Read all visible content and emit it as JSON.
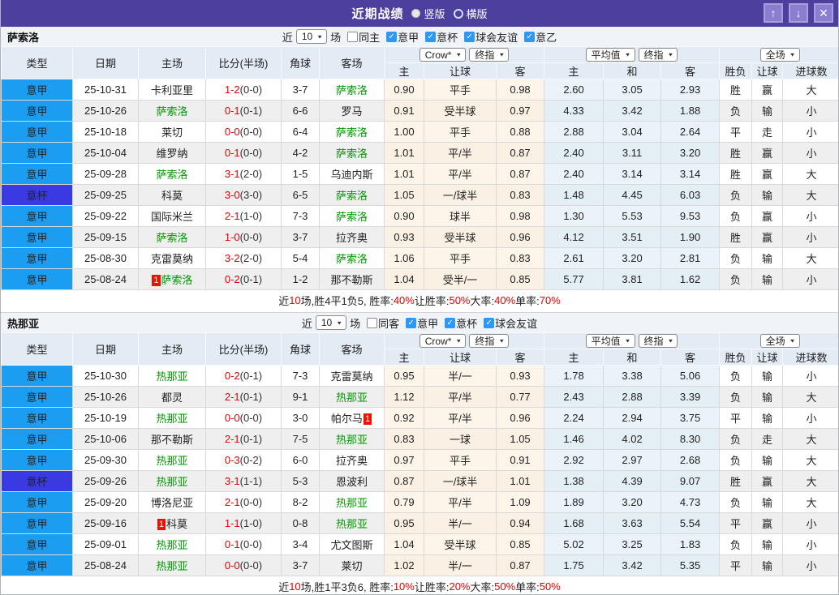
{
  "titlebar": {
    "title": "近期战绩",
    "radios": [
      {
        "label": "竖版",
        "selected": true
      },
      {
        "label": "横版",
        "selected": false
      }
    ],
    "buttons": {
      "up": "↑",
      "down": "↓",
      "close": "✕"
    }
  },
  "icons": {
    "chevron": "▼",
    "check": "✓"
  },
  "colors": {
    "header_purple": "#4c3f9d",
    "league_badge": "#1b9df2",
    "cup_badge": "#3a3ae2",
    "red": "#e60000",
    "blue": "#2433cc",
    "green": "#1f9e3d",
    "team_green": "#009900"
  },
  "header": {
    "main": [
      "类型",
      "日期",
      "主场",
      "比分(半场)",
      "角球",
      "客场"
    ],
    "odds_group": [
      "Crow*",
      "终指"
    ],
    "avg_group": [
      "平均值",
      "终指"
    ],
    "scope_group": [
      "全场"
    ],
    "sub": [
      "主",
      "让球",
      "客",
      "主",
      "和",
      "客",
      "胜负",
      "让球",
      "进球数"
    ]
  },
  "sections": [
    {
      "team": "萨索洛",
      "filter": {
        "prefix": "近",
        "games": "10",
        "suffix": "场",
        "same_label": "同主",
        "same_checked": false,
        "leagues": [
          {
            "label": "意甲",
            "checked": true
          },
          {
            "label": "意杯",
            "checked": true
          },
          {
            "label": "球会友谊",
            "checked": true
          },
          {
            "label": "意乙",
            "checked": true
          }
        ]
      },
      "rows": [
        {
          "type": "意甲",
          "cup": false,
          "date": "25-10-31",
          "home": {
            "name": "卡利亚里",
            "green": false
          },
          "score": "1-2",
          "half": "(0-0)",
          "corner": "3-7",
          "away": {
            "name": "萨索洛",
            "green": true
          },
          "odds": [
            "0.90",
            "平手",
            "0.98"
          ],
          "avg": [
            "2.60",
            "3.05",
            "2.93"
          ],
          "results": [
            [
              "胜",
              "r"
            ],
            [
              "赢",
              "r"
            ],
            [
              "大",
              "r"
            ]
          ]
        },
        {
          "type": "意甲",
          "cup": false,
          "date": "25-10-26",
          "home": {
            "name": "萨索洛",
            "green": true
          },
          "score": "0-1",
          "half": "(0-1)",
          "corner": "6-6",
          "away": {
            "name": "罗马",
            "green": false
          },
          "odds": [
            "0.91",
            "受半球",
            "0.97"
          ],
          "avg": [
            "4.33",
            "3.42",
            "1.88"
          ],
          "results": [
            [
              "负",
              "b"
            ],
            [
              "输",
              "b"
            ],
            [
              "小",
              "b"
            ]
          ]
        },
        {
          "type": "意甲",
          "cup": false,
          "date": "25-10-18",
          "home": {
            "name": "莱切",
            "green": false
          },
          "score": "0-0",
          "half": "(0-0)",
          "corner": "6-4",
          "away": {
            "name": "萨索洛",
            "green": true
          },
          "odds": [
            "1.00",
            "平手",
            "0.88"
          ],
          "avg": [
            "2.88",
            "3.04",
            "2.64"
          ],
          "results": [
            [
              "平",
              "g"
            ],
            [
              "走",
              "g"
            ],
            [
              "小",
              "b"
            ]
          ]
        },
        {
          "type": "意甲",
          "cup": false,
          "date": "25-10-04",
          "home": {
            "name": "维罗纳",
            "green": false
          },
          "score": "0-1",
          "half": "(0-0)",
          "corner": "4-2",
          "away": {
            "name": "萨索洛",
            "green": true
          },
          "odds": [
            "1.01",
            "平/半",
            "0.87"
          ],
          "avg": [
            "2.40",
            "3.11",
            "3.20"
          ],
          "results": [
            [
              "胜",
              "r"
            ],
            [
              "赢",
              "r"
            ],
            [
              "小",
              "b"
            ]
          ]
        },
        {
          "type": "意甲",
          "cup": false,
          "date": "25-09-28",
          "home": {
            "name": "萨索洛",
            "green": true
          },
          "score": "3-1",
          "half": "(2-0)",
          "corner": "1-5",
          "away": {
            "name": "乌迪内斯",
            "green": false
          },
          "odds": [
            "1.01",
            "平/半",
            "0.87"
          ],
          "avg": [
            "2.40",
            "3.14",
            "3.14"
          ],
          "results": [
            [
              "胜",
              "r"
            ],
            [
              "赢",
              "r"
            ],
            [
              "大",
              "r"
            ]
          ]
        },
        {
          "type": "意杯",
          "cup": true,
          "date": "25-09-25",
          "home": {
            "name": "科莫",
            "green": false
          },
          "score": "3-0",
          "half": "(3-0)",
          "corner": "6-5",
          "away": {
            "name": "萨索洛",
            "green": true
          },
          "odds": [
            "1.05",
            "一/球半",
            "0.83"
          ],
          "avg": [
            "1.48",
            "4.45",
            "6.03"
          ],
          "results": [
            [
              "负",
              "b"
            ],
            [
              "输",
              "b"
            ],
            [
              "大",
              "r"
            ]
          ]
        },
        {
          "type": "意甲",
          "cup": false,
          "date": "25-09-22",
          "home": {
            "name": "国际米兰",
            "green": false
          },
          "score": "2-1",
          "half": "(1-0)",
          "corner": "7-3",
          "away": {
            "name": "萨索洛",
            "green": true
          },
          "odds": [
            "0.90",
            "球半",
            "0.98"
          ],
          "avg": [
            "1.30",
            "5.53",
            "9.53"
          ],
          "results": [
            [
              "负",
              "b"
            ],
            [
              "赢",
              "r"
            ],
            [
              "小",
              "b"
            ]
          ]
        },
        {
          "type": "意甲",
          "cup": false,
          "date": "25-09-15",
          "home": {
            "name": "萨索洛",
            "green": true
          },
          "score": "1-0",
          "half": "(0-0)",
          "corner": "3-7",
          "away": {
            "name": "拉齐奥",
            "green": false
          },
          "odds": [
            "0.93",
            "受半球",
            "0.96"
          ],
          "avg": [
            "4.12",
            "3.51",
            "1.90"
          ],
          "results": [
            [
              "胜",
              "r"
            ],
            [
              "赢",
              "r"
            ],
            [
              "小",
              "b"
            ]
          ]
        },
        {
          "type": "意甲",
          "cup": false,
          "date": "25-08-30",
          "home": {
            "name": "克雷莫纳",
            "green": false
          },
          "score": "3-2",
          "half": "(2-0)",
          "corner": "5-4",
          "away": {
            "name": "萨索洛",
            "green": true
          },
          "odds": [
            "1.06",
            "平手",
            "0.83"
          ],
          "avg": [
            "2.61",
            "3.20",
            "2.81"
          ],
          "results": [
            [
              "负",
              "b"
            ],
            [
              "输",
              "b"
            ],
            [
              "大",
              "r"
            ]
          ]
        },
        {
          "type": "意甲",
          "cup": false,
          "date": "25-08-24",
          "home": {
            "name": "萨索洛",
            "green": true,
            "badge": "1",
            "badge_pos": "before"
          },
          "score": "0-2",
          "half": "(0-1)",
          "corner": "1-2",
          "away": {
            "name": "那不勒斯",
            "green": false
          },
          "odds": [
            "1.04",
            "受半/一",
            "0.85"
          ],
          "avg": [
            "5.77",
            "3.81",
            "1.62"
          ],
          "results": [
            [
              "负",
              "b"
            ],
            [
              "输",
              "b"
            ],
            [
              "小",
              "b"
            ]
          ]
        }
      ],
      "summary": [
        [
          "近",
          "k"
        ],
        [
          "10",
          "r"
        ],
        [
          "场,胜4平1负5, 胜率:",
          "k"
        ],
        [
          "40%",
          "r"
        ],
        [
          " 让胜率:",
          "k"
        ],
        [
          "50%",
          "r"
        ],
        [
          " 大率:",
          "k"
        ],
        [
          "40%",
          "r"
        ],
        [
          " 单率:",
          "k"
        ],
        [
          "70%",
          "r"
        ]
      ]
    },
    {
      "team": "热那亚",
      "filter": {
        "prefix": "近",
        "games": "10",
        "suffix": "场",
        "same_label": "同客",
        "same_checked": false,
        "leagues": [
          {
            "label": "意甲",
            "checked": true
          },
          {
            "label": "意杯",
            "checked": true
          },
          {
            "label": "球会友谊",
            "checked": true
          }
        ]
      },
      "rows": [
        {
          "type": "意甲",
          "cup": false,
          "date": "25-10-30",
          "home": {
            "name": "热那亚",
            "green": true
          },
          "score": "0-2",
          "half": "(0-1)",
          "corner": "7-3",
          "away": {
            "name": "克雷莫纳",
            "green": false
          },
          "odds": [
            "0.95",
            "半/一",
            "0.93"
          ],
          "avg": [
            "1.78",
            "3.38",
            "5.06"
          ],
          "results": [
            [
              "负",
              "b"
            ],
            [
              "输",
              "b"
            ],
            [
              "小",
              "b"
            ]
          ]
        },
        {
          "type": "意甲",
          "cup": false,
          "date": "25-10-26",
          "home": {
            "name": "都灵",
            "green": false
          },
          "score": "2-1",
          "half": "(0-1)",
          "corner": "9-1",
          "away": {
            "name": "热那亚",
            "green": true
          },
          "odds": [
            "1.12",
            "平/半",
            "0.77"
          ],
          "avg": [
            "2.43",
            "2.88",
            "3.39"
          ],
          "results": [
            [
              "负",
              "b"
            ],
            [
              "输",
              "b"
            ],
            [
              "大",
              "r"
            ]
          ]
        },
        {
          "type": "意甲",
          "cup": false,
          "date": "25-10-19",
          "home": {
            "name": "热那亚",
            "green": true
          },
          "score": "0-0",
          "half": "(0-0)",
          "corner": "3-0",
          "away": {
            "name": "帕尔马",
            "green": false,
            "badge": "1",
            "badge_pos": "after"
          },
          "odds": [
            "0.92",
            "平/半",
            "0.96"
          ],
          "avg": [
            "2.24",
            "2.94",
            "3.75"
          ],
          "results": [
            [
              "平",
              "g"
            ],
            [
              "输",
              "b"
            ],
            [
              "小",
              "b"
            ]
          ]
        },
        {
          "type": "意甲",
          "cup": false,
          "date": "25-10-06",
          "home": {
            "name": "那不勒斯",
            "green": false
          },
          "score": "2-1",
          "half": "(0-1)",
          "corner": "7-5",
          "away": {
            "name": "热那亚",
            "green": true
          },
          "odds": [
            "0.83",
            "一球",
            "1.05"
          ],
          "avg": [
            "1.46",
            "4.02",
            "8.30"
          ],
          "results": [
            [
              "负",
              "b"
            ],
            [
              "走",
              "g"
            ],
            [
              "大",
              "r"
            ]
          ]
        },
        {
          "type": "意甲",
          "cup": false,
          "date": "25-09-30",
          "home": {
            "name": "热那亚",
            "green": true
          },
          "score": "0-3",
          "half": "(0-2)",
          "corner": "6-0",
          "away": {
            "name": "拉齐奥",
            "green": false
          },
          "odds": [
            "0.97",
            "平手",
            "0.91"
          ],
          "avg": [
            "2.92",
            "2.97",
            "2.68"
          ],
          "results": [
            [
              "负",
              "b"
            ],
            [
              "输",
              "b"
            ],
            [
              "大",
              "r"
            ]
          ]
        },
        {
          "type": "意杯",
          "cup": true,
          "date": "25-09-26",
          "home": {
            "name": "热那亚",
            "green": true
          },
          "score": "3-1",
          "half": "(1-1)",
          "corner": "5-3",
          "away": {
            "name": "恩波利",
            "green": false
          },
          "odds": [
            "0.87",
            "一/球半",
            "1.01"
          ],
          "avg": [
            "1.38",
            "4.39",
            "9.07"
          ],
          "results": [
            [
              "胜",
              "r"
            ],
            [
              "赢",
              "r"
            ],
            [
              "大",
              "r"
            ]
          ]
        },
        {
          "type": "意甲",
          "cup": false,
          "date": "25-09-20",
          "home": {
            "name": "博洛尼亚",
            "green": false
          },
          "score": "2-1",
          "half": "(0-0)",
          "corner": "8-2",
          "away": {
            "name": "热那亚",
            "green": true
          },
          "odds": [
            "0.79",
            "平/半",
            "1.09"
          ],
          "avg": [
            "1.89",
            "3.20",
            "4.73"
          ],
          "results": [
            [
              "负",
              "b"
            ],
            [
              "输",
              "b"
            ],
            [
              "大",
              "r"
            ]
          ]
        },
        {
          "type": "意甲",
          "cup": false,
          "date": "25-09-16",
          "home": {
            "name": "科莫",
            "green": false,
            "badge": "1",
            "badge_pos": "before"
          },
          "score": "1-1",
          "half": "(1-0)",
          "corner": "0-8",
          "away": {
            "name": "热那亚",
            "green": true
          },
          "odds": [
            "0.95",
            "半/一",
            "0.94"
          ],
          "avg": [
            "1.68",
            "3.63",
            "5.54"
          ],
          "results": [
            [
              "平",
              "g"
            ],
            [
              "赢",
              "r"
            ],
            [
              "小",
              "b"
            ]
          ]
        },
        {
          "type": "意甲",
          "cup": false,
          "date": "25-09-01",
          "home": {
            "name": "热那亚",
            "green": true
          },
          "score": "0-1",
          "half": "(0-0)",
          "corner": "3-4",
          "away": {
            "name": "尤文图斯",
            "green": false
          },
          "odds": [
            "1.04",
            "受半球",
            "0.85"
          ],
          "avg": [
            "5.02",
            "3.25",
            "1.83"
          ],
          "results": [
            [
              "负",
              "b"
            ],
            [
              "输",
              "b"
            ],
            [
              "小",
              "b"
            ]
          ]
        },
        {
          "type": "意甲",
          "cup": false,
          "date": "25-08-24",
          "home": {
            "name": "热那亚",
            "green": true
          },
          "score": "0-0",
          "half": "(0-0)",
          "corner": "3-7",
          "away": {
            "name": "莱切",
            "green": false
          },
          "odds": [
            "1.02",
            "半/一",
            "0.87"
          ],
          "avg": [
            "1.75",
            "3.42",
            "5.35"
          ],
          "results": [
            [
              "平",
              "g"
            ],
            [
              "输",
              "b"
            ],
            [
              "小",
              "b"
            ]
          ]
        }
      ],
      "summary": [
        [
          "近",
          "k"
        ],
        [
          "10",
          "r"
        ],
        [
          "场,胜1平3负6, 胜率:",
          "k"
        ],
        [
          "10%",
          "r"
        ],
        [
          " 让胜率:",
          "k"
        ],
        [
          "20%",
          "r"
        ],
        [
          " 大率:",
          "k"
        ],
        [
          "50%",
          "r"
        ],
        [
          " 单率:",
          "k"
        ],
        [
          "50%",
          "r"
        ]
      ]
    }
  ]
}
